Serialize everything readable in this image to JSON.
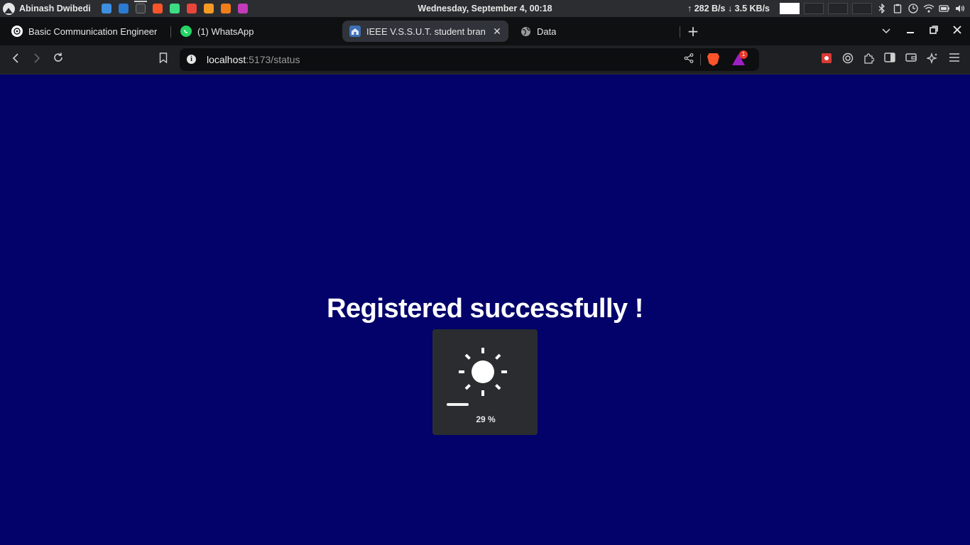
{
  "system_panel": {
    "user_name": "Abinash Dwibedi",
    "clock": "Wednesday, September   4, 00:18",
    "network_speed": "↑ 282 B/s ↓ 3.5 KB/s",
    "launcher_apps": [
      {
        "name": "files",
        "color": "#3d8fe0"
      },
      {
        "name": "vscode",
        "color": "#2c7bd1"
      },
      {
        "name": "terminal",
        "color": "#3a3c40"
      },
      {
        "name": "brave",
        "color": "#fb542b"
      },
      {
        "name": "android-studio",
        "color": "#3ddc84"
      },
      {
        "name": "app-red",
        "color": "#e8453c"
      },
      {
        "name": "app-orange",
        "color": "#f59a23"
      },
      {
        "name": "app-orange-2",
        "color": "#f07d1a"
      },
      {
        "name": "app-purple",
        "color": "#c23bb8"
      }
    ]
  },
  "tabs": [
    {
      "title": "Basic Communication Engineer",
      "favicon": "chatgpt-icon",
      "active": false
    },
    {
      "title": "(1) WhatsApp",
      "favicon": "whatsapp-icon",
      "active": false
    },
    {
      "title": "IEEE V.S.S.U.T. student bran",
      "favicon": "ieee-icon",
      "active": true
    },
    {
      "title": "Data",
      "favicon": "globe-icon",
      "active": false
    }
  ],
  "toolbar": {
    "url_host": "localhost",
    "url_path": ":5173/status",
    "rewards_badge": "1"
  },
  "page": {
    "message": "Registered successfully !"
  },
  "brightness_osd": {
    "icon": "sun-icon",
    "level": 0.29,
    "label": "29 %"
  }
}
